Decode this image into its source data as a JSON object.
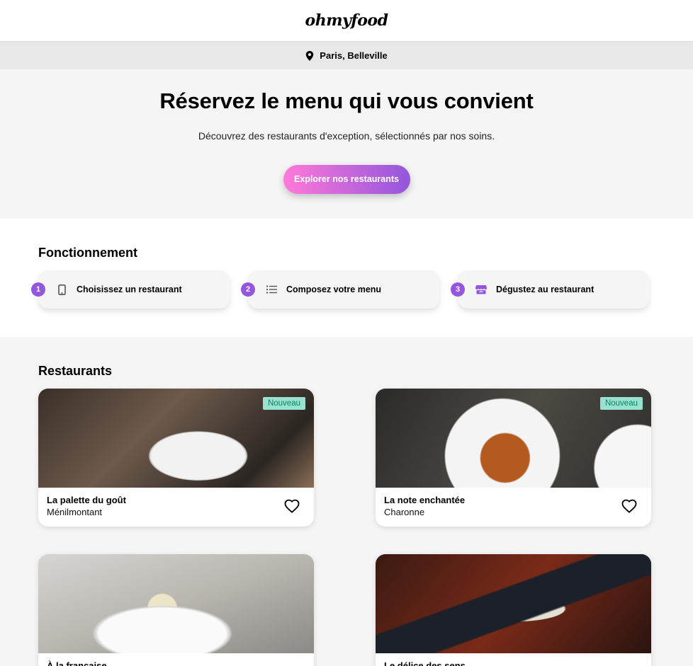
{
  "header": {
    "logo": "ohmyfood"
  },
  "location": {
    "icon": "map-pin-icon",
    "label": "Paris, Belleville"
  },
  "hero": {
    "title": "Réservez le menu qui vous convient",
    "subtitle": "Découvrez des restaurants d'exception, sélectionnés par nos soins.",
    "cta_label": "Explorer nos restaurants"
  },
  "how_it_works": {
    "title": "Fonctionnement",
    "steps": [
      {
        "number": "1",
        "icon": "phone-icon",
        "label": "Choisissez un restaurant"
      },
      {
        "number": "2",
        "icon": "list-icon",
        "label": "Composez votre menu"
      },
      {
        "number": "3",
        "icon": "store-icon",
        "label": "Dégustez au restaurant"
      }
    ]
  },
  "restaurants": {
    "title": "Restaurants",
    "items": [
      {
        "name": "La palette du goût",
        "location": "Ménilmontant",
        "badge": "Nouveau"
      },
      {
        "name": "La note enchantée",
        "location": "Charonne",
        "badge": "Nouveau"
      },
      {
        "name": "À la française",
        "location": "",
        "badge": ""
      },
      {
        "name": "Le délice des sens",
        "location": "",
        "badge": ""
      }
    ]
  },
  "colors": {
    "accent_purple": "#9356dc",
    "accent_pink": "#ff79da",
    "badge_bg": "#99e2d0",
    "badge_text": "#008766"
  }
}
